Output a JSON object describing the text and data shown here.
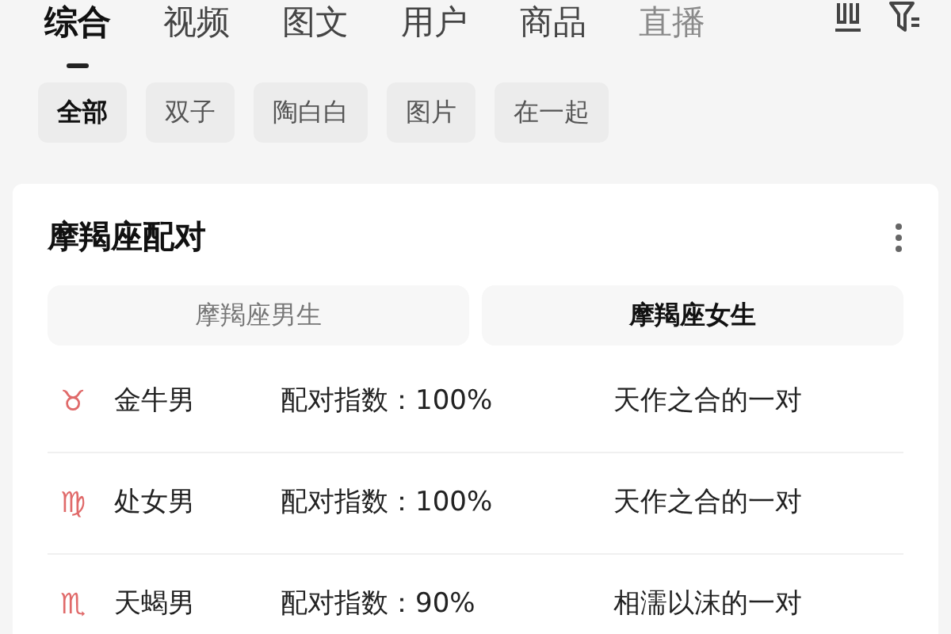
{
  "tabs": [
    {
      "label": "综合",
      "selected": true,
      "faded": false
    },
    {
      "label": "视频",
      "selected": false,
      "faded": false
    },
    {
      "label": "图文",
      "selected": false,
      "faded": false
    },
    {
      "label": "用户",
      "selected": false,
      "faded": false
    },
    {
      "label": "商品",
      "selected": false,
      "faded": false
    },
    {
      "label": "直播",
      "selected": false,
      "faded": true
    }
  ],
  "chips": [
    {
      "label": "全部",
      "selected": true
    },
    {
      "label": "双子",
      "selected": false
    },
    {
      "label": "陶白白",
      "selected": false
    },
    {
      "label": "图片",
      "selected": false
    },
    {
      "label": "在一起",
      "selected": false
    }
  ],
  "card": {
    "title": "摩羯座配对",
    "segments": [
      {
        "label": "摩羯座男生",
        "selected": false
      },
      {
        "label": "摩羯座女生",
        "selected": true
      }
    ],
    "rows": [
      {
        "symbol": "♉",
        "name": "金牛男",
        "index": "配对指数：100%",
        "description": "天作之合的一对"
      },
      {
        "symbol": "♍",
        "name": "处女男",
        "index": "配对指数：100%",
        "description": "天作之合的一对"
      },
      {
        "symbol": "♏",
        "name": "天蝎男",
        "index": "配对指数：90%",
        "description": "相濡以沫的一对"
      }
    ]
  }
}
